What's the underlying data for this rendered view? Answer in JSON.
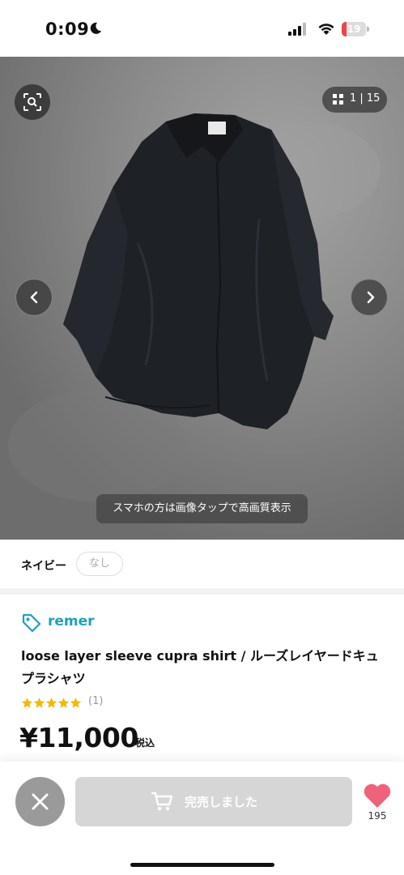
{
  "status_bar": {
    "time": "0:09",
    "battery_level": "19",
    "battery_fraction": 0.19,
    "battery_color": "#e8474a"
  },
  "gallery": {
    "counter": "1 | 15",
    "hint": "スマホの方は画像タップで高画質表示",
    "icons": {
      "lens": "image-search-icon",
      "grid": "grid-icon",
      "prev": "chevron-left-icon",
      "next": "chevron-right-icon"
    }
  },
  "variant": {
    "label": "ネイビー",
    "option": "なし"
  },
  "product": {
    "brand": "remer",
    "brand_color": "#1aa3b7",
    "title": "loose layer sleeve cupra shirt / ルーズレイヤードキュプラシャツ",
    "rating_stars": 5,
    "rating_count": "(1)",
    "price": "¥11,000",
    "tax_label": "税込"
  },
  "actions": {
    "sold_out_label": "完売しました",
    "like_count": "195",
    "like_color": "#f0627a"
  }
}
